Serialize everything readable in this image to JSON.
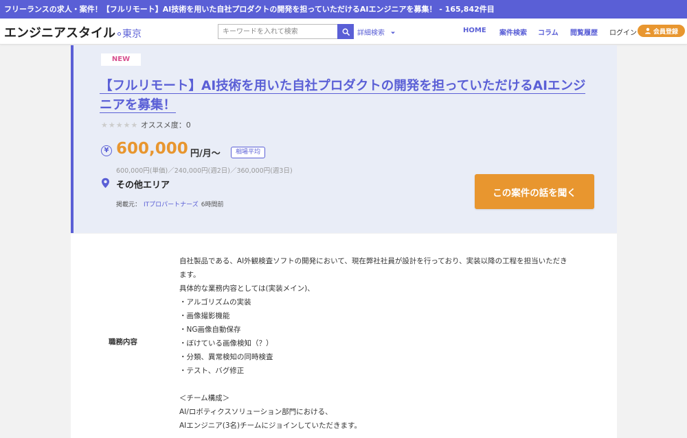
{
  "topbar": {
    "text": "フリーランスの求人・案件！【フルリモート】AI技術を用いた自社プロダクトの開発を担っていただけるAIエンジニアを募集！ - 165,842件目"
  },
  "header": {
    "logo": "エンジニアスタイル",
    "region": "東京",
    "search_placeholder": "キーワードを入れて検索",
    "advanced_search": "詳細検索",
    "nav": [
      "HOME",
      "案件検索",
      "コラム",
      "閲覧履歴"
    ],
    "login": "ログイン",
    "register": "会員登録"
  },
  "job": {
    "badge": "NEW",
    "title": "【フルリモート】AI技術を用いた自社プロダクトの開発を担っていただけるAIエンジニアを募集！",
    "rating_label": "オススメ度：0",
    "rating_value": 0,
    "rating_max": 5,
    "currency_symbol": "¥",
    "price": "600,000",
    "price_unit": "円/月〜",
    "avg_badge": "相場平均",
    "price_breakdown": "600,000円(単価)／240,000円(週2日)／360,000円(週3日)",
    "area": "その他エリア",
    "source_label": "掲載元：",
    "source_agent": "ITプロパートナーズ",
    "posted": "6時間前",
    "cta": "この案件の話を聞く"
  },
  "detail": {
    "label": "職務内容",
    "lines": [
      "自社製品である、AI外観検査ソフトの開発において、現在弊社社員が設計を行っており、実装以降の工程を担当いただき",
      "ます。",
      "具体的な業務内容としては(実装メイン)、",
      "・アルゴリズムの実装",
      "・画像撮影機能",
      "・NG画像自動保存",
      "・ぼけている画像検知（？）",
      "・分類、異常検知の同時検査",
      "・テスト、バグ修正",
      "",
      "＜チーム構成＞",
      "AI/ロボティクスソリューション部門における、",
      "AIエンジニア(3名)チームにジョインしていただきます。"
    ]
  },
  "colors": {
    "brand": "#5a5fd6",
    "accent": "#e8962f",
    "new_badge": "#d8518f",
    "hero_bg": "#e9edf7"
  },
  "icons": {
    "search": "search-icon",
    "yen": "yen-icon",
    "pin": "map-pin-icon",
    "user": "user-add-icon",
    "chevron": "chevron-down-icon"
  }
}
